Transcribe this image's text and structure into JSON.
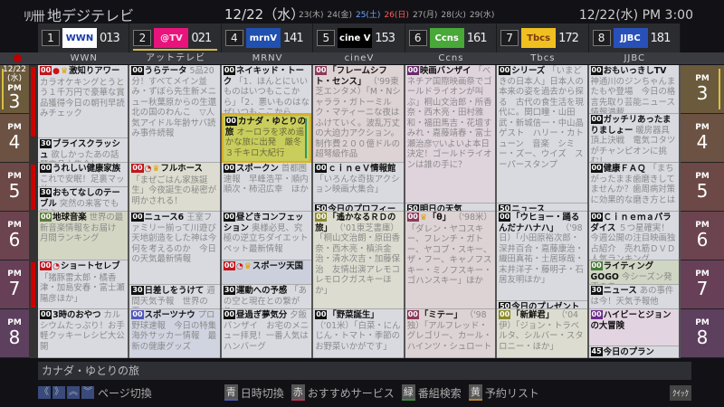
{
  "header": {
    "logo_mark": "ﾘﾘ卌",
    "app_title": "地デジテレビ",
    "current_date": "12/22（水）",
    "days": [
      {
        "t": "23(木)",
        "k": ""
      },
      {
        "t": "24(金)",
        "k": ""
      },
      {
        "t": "25(土)",
        "k": "sat"
      },
      {
        "t": "26(日)",
        "k": "sun"
      },
      {
        "t": "27(月)",
        "k": ""
      },
      {
        "t": "28(火)",
        "k": ""
      },
      {
        "t": "29(水)",
        "k": ""
      }
    ],
    "clock": "12/22(水) PM 3:00"
  },
  "time_column": {
    "date": "12/22",
    "weekday": "(水)",
    "hours": [
      {
        "pm": "PM",
        "h": "3"
      },
      {
        "pm": "PM",
        "h": "4"
      },
      {
        "pm": "PM",
        "h": "5"
      },
      {
        "pm": "PM",
        "h": "6"
      },
      {
        "pm": "PM",
        "h": "7"
      },
      {
        "pm": "PM",
        "h": "8"
      }
    ],
    "colors": [
      "#6b5a3c",
      "#6c5242",
      "#6c4846",
      "#6b4450",
      "#674058",
      "#5d3f5e"
    ]
  },
  "channels": [
    {
      "num": "1",
      "logo": "WWN",
      "logo_bg": "#ffffff",
      "logo_fg": "#1a3aa8",
      "cn": "013",
      "name": "WWN",
      "programs": [
        {
          "s": 0,
          "d": 90,
          "m": "00",
          "b": "#c0161e",
          "icons": [
            "rec",
            "crown"
          ],
          "t": "激知りアワー",
          "ds": "カラオケキングとうとう１千万円で豪華な賞品獲得今日の朝刊早読みチェック"
        },
        {
          "s": 90,
          "d": 30,
          "m": "30",
          "b": "#111",
          "t": "ブライスクラッシュ",
          "ds": "欲しかったあの話題商品大集合！"
        },
        {
          "s": 120,
          "d": 30,
          "m": "00",
          "b": "#111",
          "t": "うれしい健康家族",
          "ds": "これで安眠！足裏マッサ"
        },
        {
          "s": 150,
          "d": 30,
          "m": "30",
          "b": "#111",
          "t": "おもてなしのテーブル",
          "ds": "突然の来客でも困ら"
        },
        {
          "s": 180,
          "d": 60,
          "m": "00",
          "b": "#5a7a3a",
          "bg": "#d4d6c4",
          "t": "地球音楽",
          "ds": "世界の最新音楽情報をお届け　月間ランキング"
        },
        {
          "s": 240,
          "d": 60,
          "m": "00",
          "b": "#c0161e",
          "icons": [
            "clock"
          ],
          "t": "ショートセレブ",
          "ds": "「猪豚雷太郎・橘香津・加島安春・富士瀬陽彦ほか」"
        },
        {
          "s": 300,
          "d": 60,
          "m": "00",
          "b": "#111",
          "t": "3時のおやつ",
          "ds": "カルシウムたっぷり！お手軽クッキーレシピ大公開"
        }
      ]
    },
    {
      "num": "2",
      "logo": "@TV",
      "logo_bg": "#e8147c",
      "logo_fg": "#ffe0f0",
      "cn": "021",
      "name": "アットテレビ",
      "sel": true,
      "programs": [
        {
          "s": 0,
          "d": 120,
          "m": "00",
          "b": "#111",
          "t": "うらテータ",
          "ds": "5品20分！すべてメイン並み・ずぼら先生新メニュー秋葉原からの生還　北の国のわんこ　▽人気アイドル年齢サバ読み事件続報"
        },
        {
          "s": 120,
          "d": 60,
          "m": "00",
          "b": "#c0161e",
          "icons": [
            "clock",
            "crown"
          ],
          "bg": "#dcdcd0",
          "t": "フルホース",
          "ds": "「まぜごはん家族誕生」今夜誕生の秘密が明かされる！"
        },
        {
          "s": 180,
          "d": 90,
          "m": "00",
          "b": "#111",
          "t": "ニュース6",
          "ds": "王室ファミリー揃って川遊び天地創造をした神は今何を考えるのか　今日の天気最新情報"
        },
        {
          "s": 270,
          "d": 30,
          "m": "30",
          "b": "#111",
          "t": "日差しをうけて",
          "ds": "週間天気予報　世界の天…"
        },
        {
          "s": 300,
          "d": 60,
          "m": "00",
          "b": "#5058b8",
          "bg": "#d0d4e0",
          "t": "スポーツナウ",
          "ds": "プロ野球速報　今日の特集海外サッカー情報　最新の健康グッズ"
        }
      ]
    },
    {
      "num": "4",
      "logo": "mrnV",
      "logo_bg": "#2050b0",
      "logo_fg": "#ffffff",
      "cn": "141",
      "name": "MRNV",
      "programs": [
        {
          "s": 0,
          "d": 60,
          "m": "00",
          "b": "#111",
          "t": "ネイキッド・トーク",
          "ds": "「1．ほんとにいいものはいつもここから」「2．悪いものはなぜいつもここから"
        },
        {
          "s": 60,
          "d": 60,
          "m": "00",
          "b": "#111",
          "sel": true,
          "t": "カナダ・ゆとりの旅",
          "ds": "オーロラを求め遥かな旅に出発　厳冬３千キロ大紀行"
        },
        {
          "s": 120,
          "d": 60,
          "m": "00",
          "b": "#111",
          "t": "スポークン",
          "ds": "首都圏速報　早峰浩平・順内順次・柿沼広幸　ほか"
        },
        {
          "s": 180,
          "d": 60,
          "m": "00",
          "b": "#111",
          "t": "昼どきコンフェッション",
          "ds": "奥様必見、究極の逆立ちダイエット　ペット最新情報"
        },
        {
          "s": 240,
          "d": 30,
          "m": "00",
          "b": "#c0161e",
          "icons": [
            "clock",
            "crown"
          ],
          "bg": "#ccd0dc",
          "t": "スポーツ天国",
          "ds": ""
        },
        {
          "s": 270,
          "d": 30,
          "m": "30",
          "b": "#111",
          "t": "運動への予感",
          "ds": "「あの空と現在との繋がり…"
        },
        {
          "s": 300,
          "d": 60,
          "m": "00",
          "b": "#111",
          "t": "昼過ぎ夢気分",
          "ds": "夕飯バンザイ　お宅のメニュー拝見！一番人気はハンバーグ"
        }
      ]
    },
    {
      "num": "5",
      "logo": "cine V",
      "logo_bg": "#000000",
      "logo_fg": "#ffffff",
      "cn": "153",
      "name": "cineV",
      "programs": [
        {
          "s": 0,
          "d": 120,
          "m": "00",
          "b": "#8a3a5a",
          "bg": "#ddd2d4",
          "t": "「フレームシフト・センス」",
          "ds": "（'99東芝エンタメ）「M・Nシャララ・ガトーミルク・マティーニな夜はふけていく。波乱万丈の大迫力アクション。制作費２００億ドルの超弩級作品"
        },
        {
          "s": 120,
          "d": 50,
          "m": "00",
          "b": "#111",
          "t": "ｃｉｎｅＶ情報館",
          "ds": "「いろんな奇抜アクション映画大集合」"
        },
        {
          "s": 170,
          "d": 10,
          "m": "50",
          "b": "#111",
          "t": "今日のプロフィール",
          "ds": ""
        },
        {
          "s": 180,
          "d": 120,
          "m": "00",
          "b": "#8a8a2a",
          "bg": "#dcdcd0",
          "t": "「遙かなるＲＤの旅」",
          "ds": "（'01東芝書庫）「桐山文治朗・原田香奈・西木亮・槙浜金治・清水次吉・加藤保治　友情出演アレモコレモロクガスキーほか」"
        },
        {
          "s": 300,
          "d": 60,
          "m": "00",
          "b": "#111",
          "t": "「野菜誕生」",
          "ds": "（'01米）「白菜・にんじん・トマト・季節のお野菜いかがです」"
        }
      ]
    },
    {
      "num": "6",
      "logo": "Ccns",
      "logo_bg": "#48a838",
      "logo_fg": "#ffffff",
      "cn": "161",
      "name": "Ccns",
      "programs": [
        {
          "s": 0,
          "d": 170,
          "m": "00",
          "b": "#6a2a6a",
          "bg": "#e0d4dc",
          "t": "映画バンザイ",
          "ds": "「ベネチア国際映画祭でゴールドライオンが叫ぶ」桐山文治郎・所香奈・西木亮・田村雅和・福田馬吉・花壇すみれ・嘉藤靖春・富士瀬治彦▽いよいよ本日決定！ゴールドライオンは誰の手に？"
        },
        {
          "s": 170,
          "d": 10,
          "m": "50",
          "b": "#111",
          "t": "明日の天気",
          "ds": ""
        },
        {
          "s": 180,
          "d": 120,
          "m": "00",
          "b": "#8a3a5a",
          "icons": [
            "crown"
          ],
          "bg": "#ddd2d4",
          "t": "「θ」",
          "ds": "（'98米）「ダレン・ヤコスキー、フレンチ・ガトー、ヤコブ・スキー、ザ・フー、キャノフスキー・ミノフスキー・ゴハンスキー」ほか"
        },
        {
          "s": 300,
          "d": 60,
          "m": "00",
          "b": "#8a3a5a",
          "bg": "#ddd2d4",
          "t": "「ミテー」",
          "ds": "（'98独）「アルフレッド・グレゴリー、カール・ハインツ・シュロート"
        }
      ]
    },
    {
      "num": "7",
      "logo": "Tbcs",
      "logo_bg": "#f0c020",
      "logo_fg": "#7a3a10",
      "cn": "172",
      "name": "Tbcs",
      "programs": [
        {
          "s": 0,
          "d": 170,
          "m": "00",
          "b": "#111",
          "t": "シリーズ",
          "ds": "「いまどきの日本人」日本人の本来の姿を過去から探る　古代の食生活を現代に。関口瞳・山田武・新城信一・中山晶　ゲスト　ハリー・カトューン　音楽　シミー・ズー、ウイズ　スーパースタンプ"
        },
        {
          "s": 170,
          "d": 10,
          "m": "50",
          "b": "#111",
          "t": "ニュース",
          "ds": ""
        },
        {
          "s": 180,
          "d": 110,
          "m": "00",
          "b": "#111",
          "t": "「ウヒョー・踊るんだナハナハ」",
          "ds": "（'98日）「小田原裕次郎・深井百合・嘉藤康治・織田真祐・土居琢哉・末井洋子・藤明子・石居友明ほか」"
        },
        {
          "s": 290,
          "d": 10,
          "m": "50",
          "b": "#111",
          "t": "今日のプレゼント",
          "ds": ""
        },
        {
          "s": 300,
          "d": 60,
          "m": "00",
          "b": "#8a8a2a",
          "bg": "#dcdcd0",
          "t": "「新鮮君」",
          "ds": "（'04伊）「ジョン・トラベルタ、シルバー・スタロニー・ほか」"
        }
      ]
    },
    {
      "num": "8",
      "logo": "JJBC",
      "logo_bg": "#2850b8",
      "logo_fg": "#ffffff",
      "cn": "181",
      "name": "JJBC",
      "programs": [
        {
          "s": 0,
          "d": 60,
          "m": "00",
          "b": "#111",
          "t": "おもいっきしTV",
          "ds": "神通川のジンちゃんまたもや登場　今日の格言先取り芸能ニュース情報満載"
        },
        {
          "s": 60,
          "d": 60,
          "m": "00",
          "b": "#111",
          "t": "ガッチリあったまりましょー",
          "ds": "暖房器具頂上決戦　電気コタツがチャンピオンに挑む！"
        },
        {
          "s": 120,
          "d": 60,
          "m": "00",
          "b": "#111",
          "t": "健康ＦＡＱ",
          "ds": "「まちがったまま歯磨きしてませんか？歯周病対策に効果的な磨き方とは"
        },
        {
          "s": 180,
          "d": 60,
          "m": "00",
          "b": "#111",
          "t": "Ｃｉｎｅｍａパラダイス",
          "ds": "５つ星確実！今週公開の注目映画独占紹介　売れ筋ＤＶＤ人気ランキング"
        },
        {
          "s": 240,
          "d": 30,
          "m": "00",
          "b": "#4a7a3a",
          "bg": "#d0d6c4",
          "t": "ライティングGOGO",
          "ds": "今シーズン発売のあ"
        },
        {
          "s": 270,
          "d": 30,
          "m": "30",
          "b": "#111",
          "t": "ニュース",
          "ds": "あの事件は今！天気予報他"
        },
        {
          "s": 300,
          "d": 45,
          "m": "00",
          "b": "#6a2a8a",
          "bg": "#e2d4e0",
          "t": "ハイビーとジョンの大冒険",
          "ds": ""
        },
        {
          "s": 345,
          "d": 15,
          "m": "45",
          "b": "#111",
          "t": "今日のプラン",
          "ds": ""
        }
      ]
    }
  ],
  "selected_title": "カナダ・ゆとりの旅",
  "footer": {
    "nav": [
      "《",
      "》",
      "︽",
      "︾"
    ],
    "page_label": "ページ切換",
    "blue_key": "青",
    "blue_label": "日時切換",
    "red_key": "赤",
    "red_label": "おすすめサービス",
    "green_key": "緑",
    "green_label": "番組検索",
    "yellow_key": "黄",
    "yellow_label": "予約リスト",
    "quick": "ｸｲｯｸ"
  },
  "key_colors": {
    "blue": "#4a5ab8",
    "red": "#c03050",
    "green": "#3a8a3a",
    "yellow": "#c08020"
  },
  "progress_bars": [
    {
      "col": "WWN",
      "s": 0,
      "d": 90
    },
    {
      "col": "WWN",
      "s": 120,
      "d": 60
    },
    {
      "col": "WWN",
      "s": 240,
      "d": 60
    }
  ]
}
